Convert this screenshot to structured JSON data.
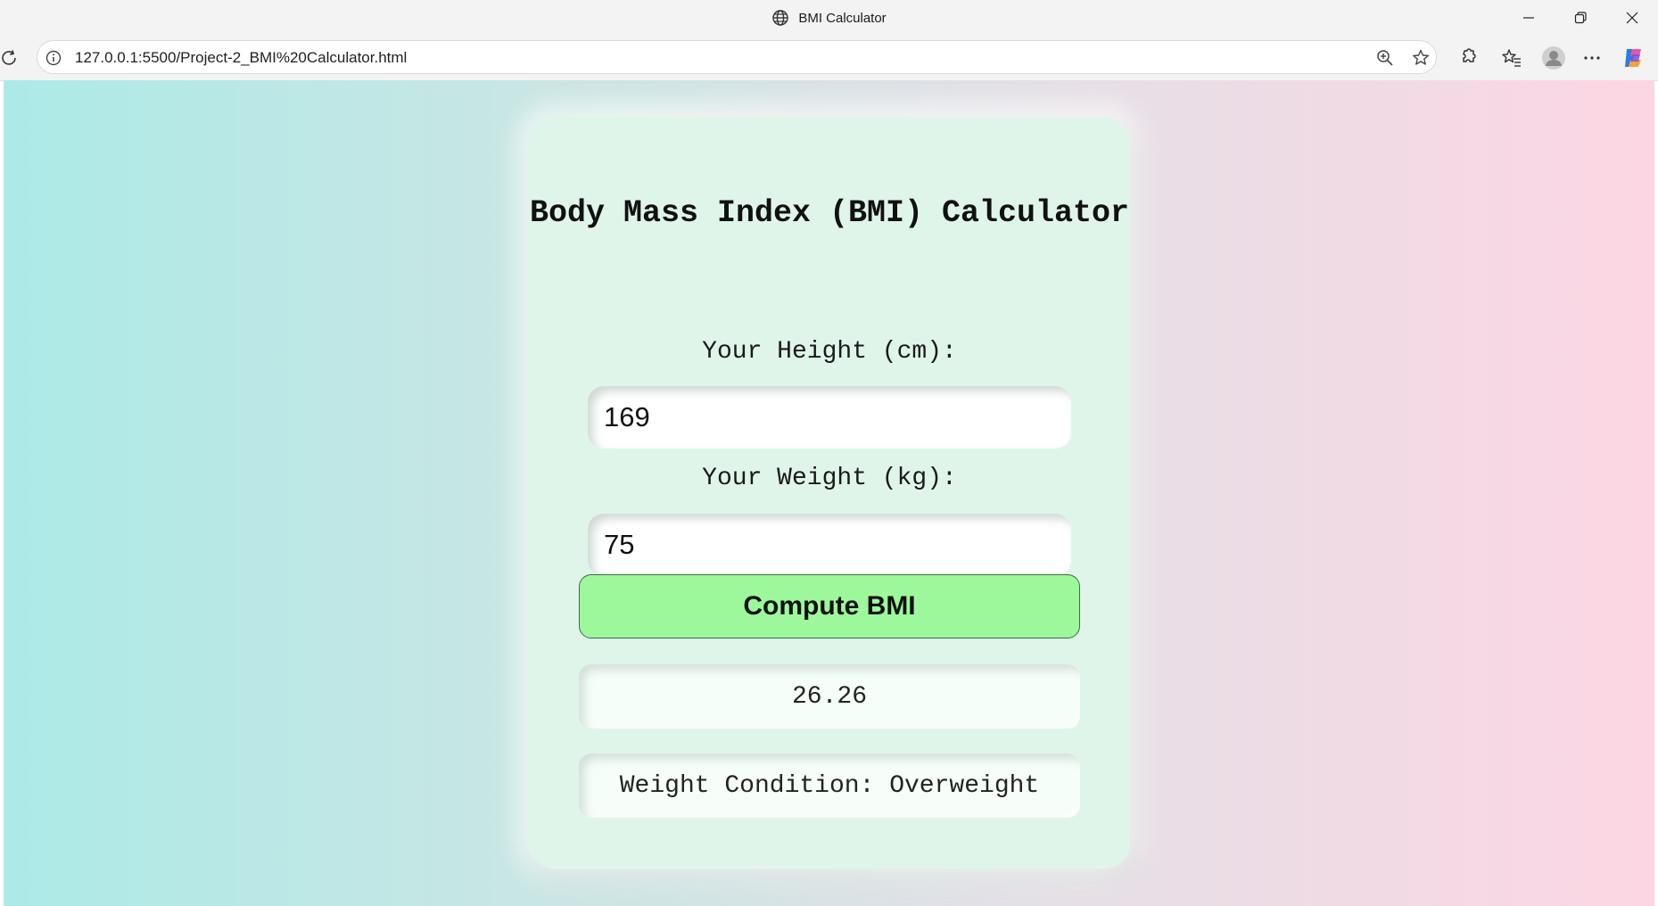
{
  "window": {
    "title": "BMI Calculator"
  },
  "browser": {
    "url": "127.0.0.1:5500/Project-2_BMI%20Calculator.html"
  },
  "page": {
    "heading": "Body Mass Index (BMI) Calculator",
    "height_label": "Your Height (cm):",
    "height_value": "169",
    "weight_label": "Your Weight (kg):",
    "weight_value": "75",
    "compute_label": "Compute BMI",
    "bmi_result": "26.26",
    "condition_text": "Weight Condition: Overweight"
  },
  "colors": {
    "card_background": "#e0f5ea",
    "button_background": "#9df89c",
    "gradient_left": "#aceae7",
    "gradient_right": "#fcd6e3"
  },
  "icons": {
    "title": "globe-icon",
    "address_bar": [
      "info-icon",
      "zoom-icon",
      "star-icon"
    ],
    "toolbar": [
      "extensions-icon",
      "favorites-icon",
      "profile-icon",
      "more-icon",
      "copilot-icon"
    ],
    "window_controls": [
      "minimize-icon",
      "restore-icon",
      "close-icon"
    ]
  }
}
